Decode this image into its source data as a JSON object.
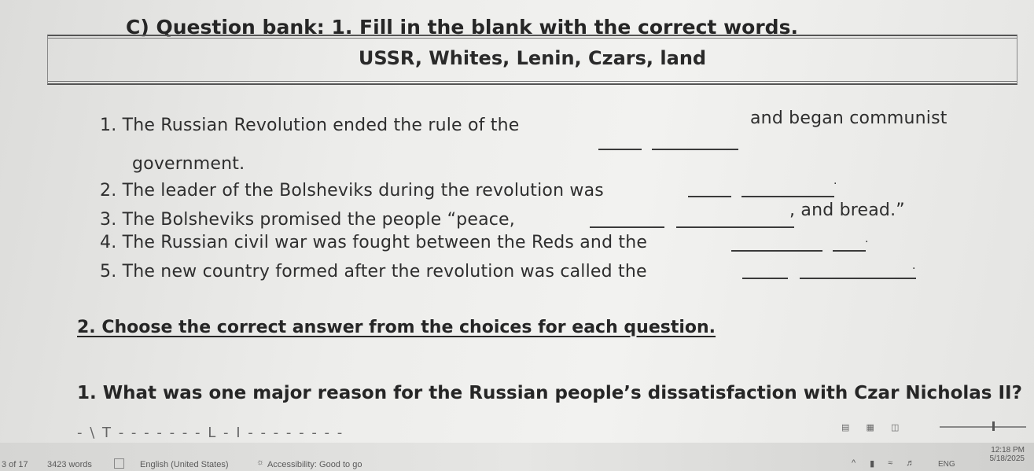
{
  "section_c": {
    "title": "C) Question bank: 1. Fill in the blank with the correct words."
  },
  "word_bank": "USSR, Whites, Lenin, Czars, land",
  "fill_in": [
    {
      "number": "1.",
      "before": "The Russian Revolution ended the rule of the",
      "after": "and began communist",
      "continuation": "government."
    },
    {
      "number": "2.",
      "before": "The leader of the Bolsheviks during the revolution was",
      "after": "."
    },
    {
      "number": "3.",
      "before": "The Bolsheviks promised the people “peace,",
      "after": ", and bread.”"
    },
    {
      "number": "4.",
      "before": "The Russian civil war was fought between the Reds and the",
      "after": "."
    },
    {
      "number": "5.",
      "before": "The new country formed after the revolution was called the",
      "after": "."
    }
  ],
  "section_2": {
    "title": "2.  Choose the correct answer from the choices for each question.",
    "question_1": "1. What was one major reason for the Russian people’s dissatisfaction with Czar Nicholas II?",
    "cutoff_line": "- \\ T - -  - - - - - L  - I - - - - - - - -"
  },
  "status_bar": {
    "page": "3 of 17",
    "words": "3423 words",
    "language": "English (United States)",
    "accessibility": "Accessibility: Good to go",
    "time": "12:18 PM",
    "date": "5/18/2025",
    "lang_indicator": "ENG"
  }
}
